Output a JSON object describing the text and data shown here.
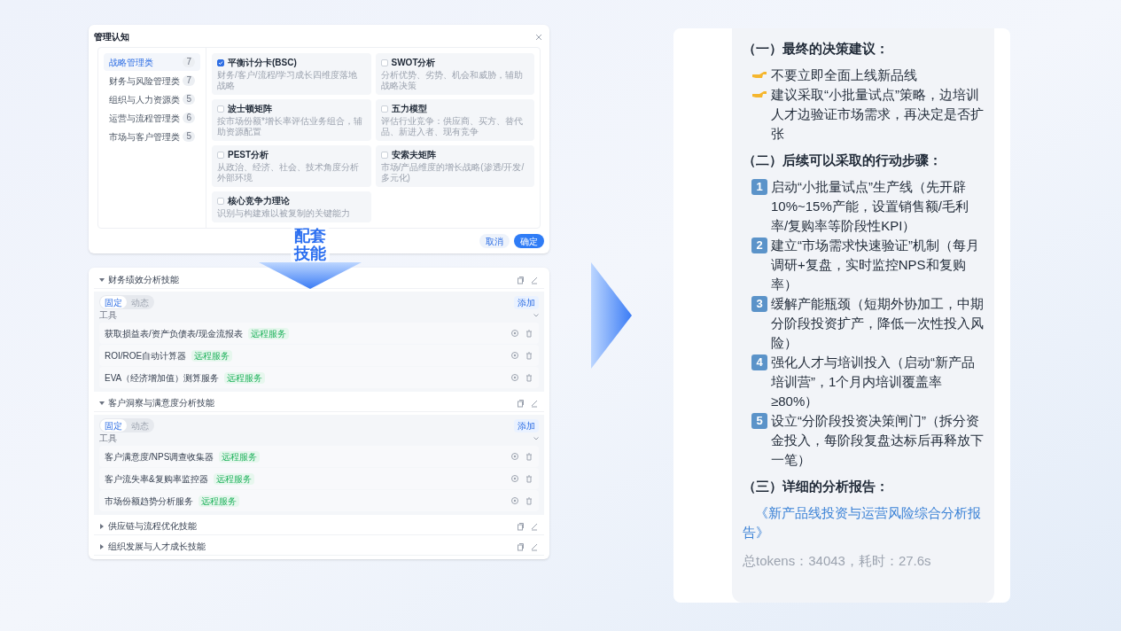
{
  "dialog": {
    "title": "管理认知",
    "categories": [
      {
        "label": "战略管理类",
        "count": "7",
        "selected": true
      },
      {
        "label": "财务与风险管理类",
        "count": "7",
        "selected": false
      },
      {
        "label": "组织与人力资源类",
        "count": "5",
        "selected": false
      },
      {
        "label": "运营与流程管理类",
        "count": "6",
        "selected": false
      },
      {
        "label": "市场与客户管理类",
        "count": "5",
        "selected": false
      }
    ],
    "models": [
      {
        "name": "平衡计分卡(BSC)",
        "description": "财务/客户/流程/学习成长四维度落地战略",
        "checked": true
      },
      {
        "name": "SWOT分析",
        "description": "分析优势、劣势、机会和威胁，辅助战略决策",
        "checked": false
      },
      {
        "name": "波士顿矩阵",
        "description": "按市场份额*增长率评估业务组合，辅助资源配置",
        "checked": false
      },
      {
        "name": "五力模型",
        "description": "评估行业竞争：供应商、买方、替代品、新进入者、现有竞争",
        "checked": false
      },
      {
        "name": "PEST分析",
        "description": "从政治、经济、社会、技术角度分析外部环境",
        "checked": false
      },
      {
        "name": "安索夫矩阵",
        "description": "市场/产品维度的增长战略(渗透/开发/多元化)",
        "checked": false
      },
      {
        "name": "核心竞争力理论",
        "description": "识别与构建难以被复制的关键能力",
        "checked": false
      }
    ],
    "buttons": [
      {
        "label": "取消",
        "kind": "secondary"
      },
      {
        "label": "确定",
        "kind": "primary"
      }
    ]
  },
  "banner": {
    "lines": [
      "配套",
      "技能"
    ]
  },
  "skills": [
    {
      "title": "财务绩效分析技能",
      "expanded": true,
      "modes": [
        {
          "label": "固定",
          "selected": true
        },
        {
          "label": "动态",
          "selected": false
        }
      ],
      "add_label": "添加",
      "section_label": "工具",
      "tools": [
        {
          "name": "获取损益表/资产负债表/现金流报表",
          "tag": "远程服务"
        },
        {
          "name": "ROI/ROE自动计算器",
          "tag": "远程服务"
        },
        {
          "name": "EVA（经济增加值）测算服务",
          "tag": "远程服务"
        }
      ]
    },
    {
      "title": "客户洞察与满意度分析技能",
      "expanded": true,
      "modes": [
        {
          "label": "固定",
          "selected": true
        },
        {
          "label": "动态",
          "selected": false
        }
      ],
      "add_label": "添加",
      "section_label": "工具",
      "tools": [
        {
          "name": "客户满意度/NPS调查收集器",
          "tag": "远程服务"
        },
        {
          "name": "客户流失率&复购率监控器",
          "tag": "远程服务"
        },
        {
          "name": "市场份额趋势分析服务",
          "tag": "远程服务"
        }
      ]
    },
    {
      "title": "供应链与流程优化技能",
      "expanded": false
    },
    {
      "title": "组织发展与人才成长技能",
      "expanded": false
    }
  ],
  "answer": {
    "blocks": [
      {
        "kind": "heading",
        "text": "（一）最终的决策建议："
      },
      {
        "kind": "bullet",
        "text": "不要立即全面上线新品线"
      },
      {
        "kind": "bullet",
        "text": "建议采取“小批量试点”策略，边培训人才边验证市场需求，再决定是否扩张"
      },
      {
        "kind": "heading",
        "text": "（二）后续可以采取的行动步骤："
      },
      {
        "kind": "step",
        "number": "1",
        "text": "启动“小批量试点”生产线（先开辟10%~15%产能，设置销售额/毛利率/复购率等阶段性KPI）"
      },
      {
        "kind": "step",
        "number": "2",
        "text": "建立“市场需求快速验证”机制（每月调研+复盘，实时监控NPS和复购率）"
      },
      {
        "kind": "step",
        "number": "3",
        "text": "缓解产能瓶颈（短期外协加工，中期分阶段投资扩产，降低一次性投入风险）"
      },
      {
        "kind": "step",
        "number": "4",
        "text": "强化人才与培训投入（启动“新产品培训营”，1个月内培训覆盖率≥80%）"
      },
      {
        "kind": "step",
        "number": "5",
        "text": "设立“分阶段投资决策闸门”（拆分资金投入，每阶段复盘达标后再释放下一笔）"
      },
      {
        "kind": "heading",
        "text": "（三）详细的分析报告："
      },
      {
        "kind": "link",
        "text": "《新产品线投资与运营风险综合分析报告》"
      },
      {
        "kind": "meta",
        "text": "总tokens：34043，耗时：27.6s"
      }
    ]
  }
}
